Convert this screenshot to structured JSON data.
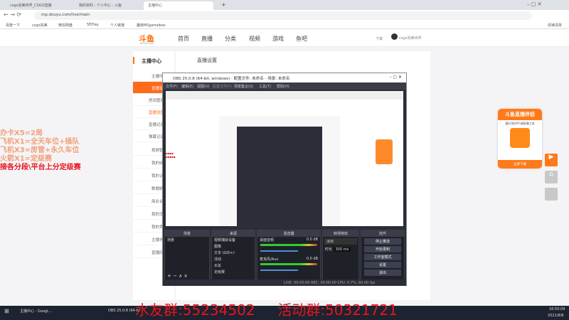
{
  "browser": {
    "tabs": [
      "csgo完美世界_CSGO直播",
      "我的资料 - 个人中心 - 斗鱼",
      "主播中心"
    ],
    "url": "mp.douyu.com/live/main",
    "bookmarks": [
      "百度一下",
      "csgo完美",
      "微信网盘",
      "5EPlay",
      "个人链接",
      "魔兽MSgamebox"
    ],
    "reading_list": "阅读清单"
  },
  "site": {
    "logo": "斗鱼",
    "logo_sub": "douyu.com",
    "nav": [
      "首页",
      "直播",
      "分类",
      "视频",
      "游戏",
      "鱼吧"
    ],
    "download": "下载",
    "user": "csgo完美世界"
  },
  "sidebar": {
    "title": "主播中心",
    "items": [
      "主播中心",
      "直播设置",
      "房间管理",
      "直播设置",
      "直播记录",
      "弹幕记录",
      "视频管理",
      "我的收益",
      "我的认证",
      "数据统计",
      "商业合作",
      "我的活动",
      "我的竞猜",
      "主播学院",
      "直播间"
    ]
  },
  "main": {
    "title": "直播设置"
  },
  "notes": [
    "办卡X5=2局",
    "飞机X1=全天车位+插队",
    "飞机X3=房管+永久车位",
    "火箭X1=定级赛",
    "接各分段\\平台上分定级赛"
  ],
  "obs": {
    "title": "OBS 25.0.8 (64-bit, windows) - 配置文件: 未命名 - 场景: 未命名",
    "menu": [
      "文件(F)",
      "编辑(E)",
      "视图(V)",
      "配置文件(P)",
      "场景集合(S)",
      "工具(T)",
      "帮助(H)"
    ],
    "docks": {
      "scenes": "场景",
      "sources": "来源",
      "mixer": "混音器",
      "transitions": "转场特效",
      "controls": "控件"
    },
    "scene_items": [
      "场景"
    ],
    "source_items": [
      "视频捕获设备",
      "图像",
      "文本 (GDI+)",
      "活动",
      "水友",
      "定级赛"
    ],
    "mixer": [
      {
        "name": "桌面音频",
        "db": "0.0 dB"
      },
      {
        "name": "麦克风/Aux",
        "db": "0.0 dB"
      }
    ],
    "transition": "淡出",
    "duration_label": "时长",
    "duration": "300 ms",
    "controls": [
      "停止推流",
      "开始录制",
      "工作室模式",
      "设置",
      "退出"
    ],
    "status": "LIVE: 00:00:00   REC: 00:00:00   CPU: 0.7%, 60.00 fps"
  },
  "promo": {
    "title": "斗鱼直播伴侣",
    "desc": "最好用的PC端直播工具",
    "btn": "立即下载"
  },
  "overlay": "水友群:55234502     活动群:50321721",
  "taskbar": {
    "items": [
      "主播中心 - Googl...",
      "OBS 25.0.8 (64-bi..."
    ],
    "time": "16:50:09",
    "date": "2021/8/8"
  },
  "colors": {
    "accent": "#ff7700",
    "red": "#e8141e"
  }
}
